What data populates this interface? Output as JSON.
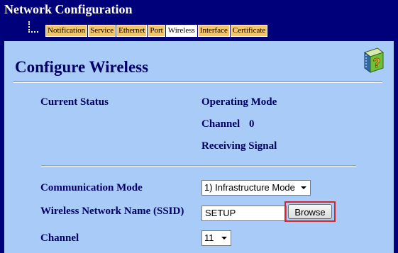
{
  "header": {
    "title": "Network Configuration"
  },
  "tabs": [
    {
      "label": "Notification",
      "active": false
    },
    {
      "label": "Service",
      "active": false
    },
    {
      "label": "Ethernet",
      "active": false
    },
    {
      "label": "Port",
      "active": false
    },
    {
      "label": "Wireless",
      "active": true
    },
    {
      "label": "Interface",
      "active": false
    },
    {
      "label": "Certificate",
      "active": false
    }
  ],
  "panel": {
    "title": "Configure Wireless",
    "help_icon": "help-book-icon"
  },
  "status": {
    "current_status_label": "Current Status",
    "operating_mode_label": "Operating Mode",
    "channel_label": "Channel",
    "channel_value": "0",
    "receiving_signal_label": "Receiving Signal"
  },
  "form": {
    "communication_mode_label": "Communication Mode",
    "communication_mode_value": "1) Infrastructure Mode",
    "ssid_label": "Wireless Network Name (SSID)",
    "ssid_value": "SETUP",
    "browse_label": "Browse",
    "channel_label": "Channel",
    "channel_value": "11"
  },
  "colors": {
    "background": "#00007a",
    "panel": "#a9cbf8",
    "tab": "#f2c56c",
    "label_text": "#000066",
    "highlight": "#d7252a"
  }
}
